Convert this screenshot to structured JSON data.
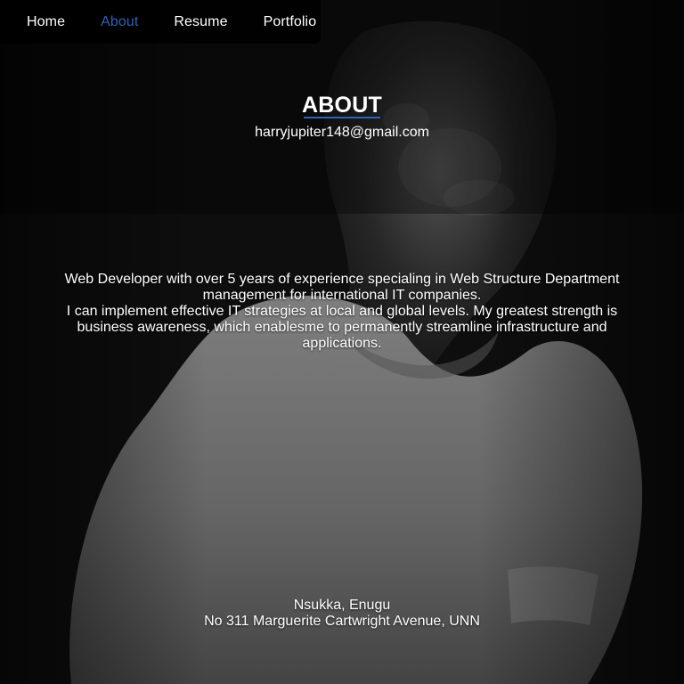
{
  "nav": {
    "items": [
      {
        "label": "Home",
        "active": false
      },
      {
        "label": "About",
        "active": true
      },
      {
        "label": "Resume",
        "active": false
      },
      {
        "label": "Portfolio",
        "active": false
      }
    ],
    "active_color": "#2e63b8"
  },
  "about": {
    "title": "ABOUT",
    "email": "harryjupiter148@gmail.com",
    "bio_line_1": "Web Developer with over 5 years of experience specialing in Web Structure Department management for international IT companies.",
    "bio_line_2": "I can implement effective IT strategies at local and global levels. My greatest strength is business awareness, which enablesme to permanently streamline infrastructure and applications."
  },
  "address": {
    "city": "Nsukka, Enugu",
    "street": "No 311 Marguerite Cartwright Avenue, UNN"
  },
  "colors": {
    "background": "#0f0f0f",
    "text": "#ffffff",
    "accent": "#2e63b8"
  }
}
